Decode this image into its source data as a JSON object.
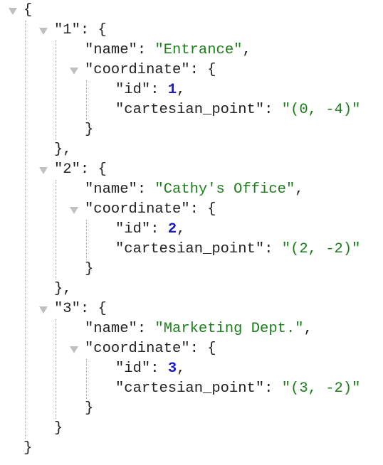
{
  "document": {
    "1": {
      "name": "Entrance",
      "coordinate": {
        "id": 1,
        "cartesian_point": "(0, -4)"
      }
    },
    "2": {
      "name": "Cathy's Office",
      "coordinate": {
        "id": 2,
        "cartesian_point": "(2, -2)"
      }
    },
    "3": {
      "name": "Marketing Dept.",
      "coordinate": {
        "id": 3,
        "cartesian_point": "(3, -2)"
      }
    }
  },
  "colors": {
    "key": "#222222",
    "string": "#1a7f1a",
    "number": "#1a1ac6",
    "toggle": "#c0c0c0"
  }
}
